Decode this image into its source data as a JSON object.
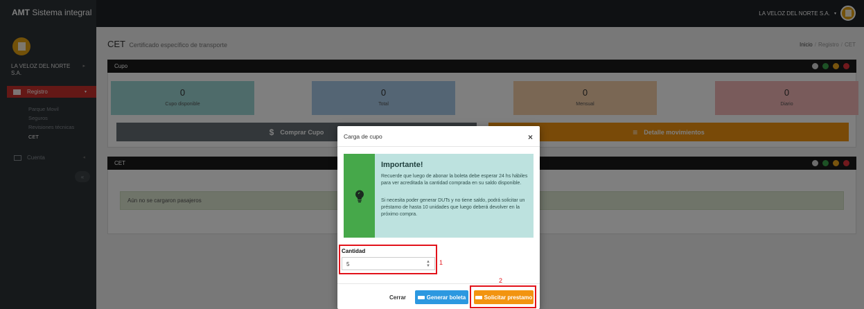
{
  "app": {
    "brand_bold": "AMT",
    "brand_rest": " Sistema integral"
  },
  "topbar": {
    "user": "LA VELOZ DEL NORTE S.A.",
    "caret": "▾"
  },
  "sidebar": {
    "company": "LA VELOZ DEL NORTE S.A.",
    "registro": "Registro",
    "sub_items": [
      "Parque Movil",
      "Seguros",
      "Revisiones técnicas",
      "CET"
    ],
    "cuenta": "Cuenta",
    "collapse": "«"
  },
  "header": {
    "title": "CET",
    "subtitle": "Certificado específico de transporte",
    "breadcrumb": [
      "Inicio",
      "Registro",
      "CET"
    ]
  },
  "panel_cupo": {
    "title": "Cupo",
    "stats": [
      {
        "value": "0",
        "label": "Cupo disponible",
        "color": "#9dd7d5"
      },
      {
        "value": "0",
        "label": "Total",
        "color": "#a9cbe9"
      },
      {
        "value": "0",
        "label": "Mensual",
        "color": "#f5cfa9"
      },
      {
        "value": "0",
        "label": "Diario",
        "color": "#f3b6b6"
      }
    ],
    "buy_button": "Comprar Cupo",
    "buy_icon": "$",
    "movements_button": "Detalle movimientos",
    "movements_icon": "≡"
  },
  "panel_cet": {
    "title": "CET",
    "empty_message": "Aún no se cargaron pasajeros"
  },
  "modal": {
    "title": "Carga de cupo",
    "close": "×",
    "info_title": "Importante!",
    "info_p1": "Recuerde que luego de abonar la boleta debe esperar 24 hs hábiles para ver acreditada la cantidad comprada en su saldo disponible.",
    "info_p2": "Si necesita poder generar DUTs y no tiene saldo, podrá solicitar un préstamo de hasta 10 unidades que luego deberá devolver en la próximo compra.",
    "cantidad_label": "Cantidad",
    "cantidad_value": "5",
    "cerrar": "Cerrar",
    "generar": "Generar boleta",
    "solicitar": "Solicitar prestamo"
  },
  "annotations": {
    "one": "1",
    "two": "2"
  },
  "colors": {
    "accent_red": "#c9302c",
    "orange": "#f29410",
    "blue": "#2c98e0",
    "green": "#46a84a"
  }
}
